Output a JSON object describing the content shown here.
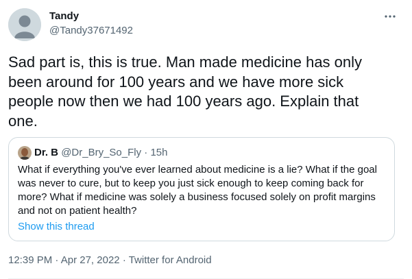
{
  "tweet": {
    "author": {
      "name": "Tandy",
      "handle": "@Tandy37671492"
    },
    "more_icon": "more-horizontal-icon",
    "text": "Sad part is, this is true. Man made medicine has only been around for 100 years and we have more sick people now then we had 100 years ago. Explain that one.",
    "quote": {
      "name": "Dr. B",
      "handle": "@Dr_Bry_So_Fly",
      "separator": "·",
      "time": "15h",
      "text": "What if everything you've ever learned about medicine is a lie? What if the goal was never to cure, but to keep you just sick enough to keep coming back for more? What if medicine was solely a business focused solely on profit margins and not on patient health?",
      "show_thread": "Show this thread"
    },
    "meta": {
      "time": "12:39 PM",
      "separator": "·",
      "date": "Apr 27, 2022",
      "source": "Twitter for Android"
    }
  },
  "colors": {
    "text": "#0f1419",
    "secondary": "#536471",
    "link": "#1d9bf0",
    "border": "#cfd9de"
  }
}
